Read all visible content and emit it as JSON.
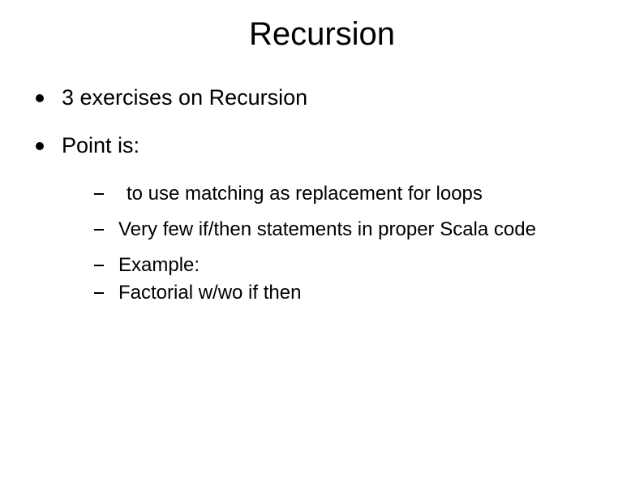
{
  "title": "Recursion",
  "bullets": {
    "b1": "3 exercises on Recursion",
    "b2": "Point is:"
  },
  "subbullets": {
    "s1": " to use matching as replacement for loops",
    "s2": "Very few if/then statements in proper Scala code",
    "s3": "Example:",
    "s4": "Factorial w/wo if then"
  }
}
